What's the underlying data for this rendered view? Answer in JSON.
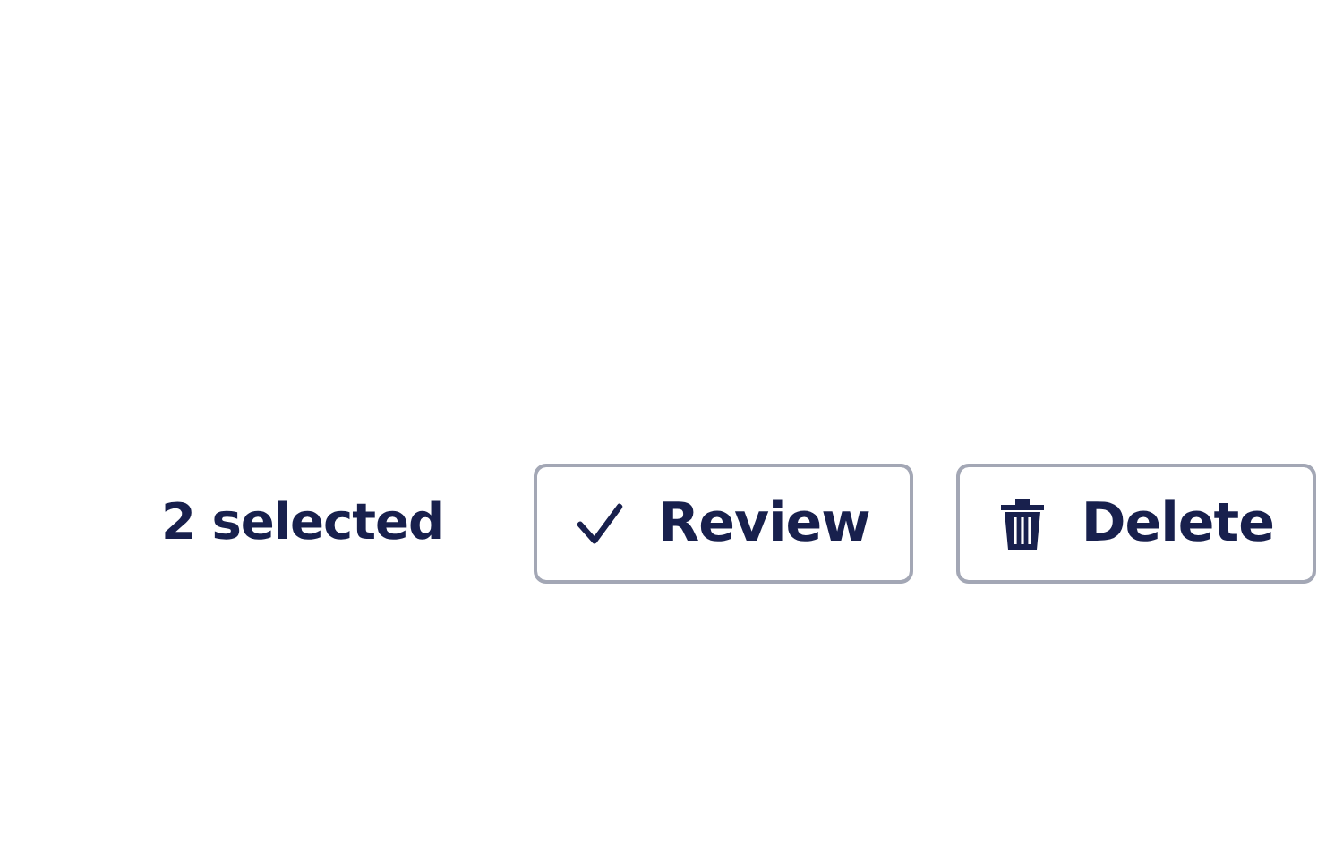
{
  "selection_count": "2 selected",
  "buttons": [
    {
      "kind": "check",
      "label": "Review"
    },
    {
      "kind": "trash",
      "label": "Delete"
    }
  ]
}
